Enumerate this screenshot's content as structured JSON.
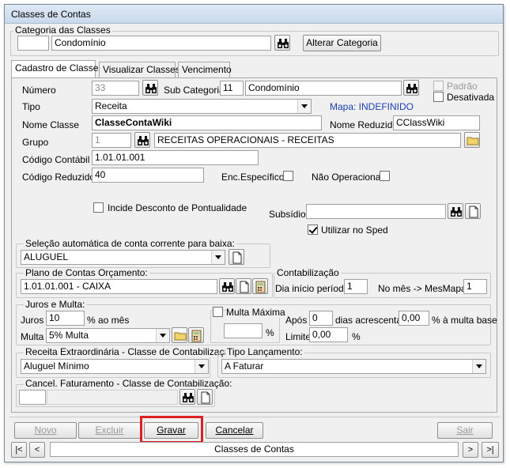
{
  "window": {
    "title": "Classes de Contas"
  },
  "categoria": {
    "legend": "Categoria das Classes",
    "code": "",
    "name": "Condomínio",
    "alterar_label": "Alterar Categoria"
  },
  "tabs": [
    {
      "label": "Cadastro de Classes"
    },
    {
      "label": "Visualizar Classes"
    },
    {
      "label": "Vencimento"
    }
  ],
  "form": {
    "numero_label": "Número",
    "numero": "33",
    "subcat_label": "Sub Categoria",
    "subcat_code": "11",
    "subcat_name": "Condomínio",
    "padrao_label": "Padrão",
    "desativada_label": "Desativada",
    "tipo_label": "Tipo",
    "tipo": "Receita",
    "mapa": "Mapa: INDEFINIDO",
    "nome_classe_label": "Nome Classe",
    "nome_classe": "ClasseContaWiki",
    "nome_reduzido_label": "Nome Reduzido",
    "nome_reduzido": "CClassWiki",
    "grupo_label": "Grupo",
    "grupo_code": "1",
    "grupo_name": "RECEITAS OPERACIONAIS - RECEITAS",
    "codigo_contabil_label": "Código Contábil",
    "codigo_contabil": "1.01.01.001",
    "codigo_reduzido_label": "Código Reduzido",
    "codigo_reduzido": "40",
    "enc_especifico_label": "Enc.Específico",
    "nao_operacional_label": "Não Operacional",
    "incide_label": "Incide Desconto de Pontualidade",
    "subsidio_label": "Subsídio",
    "subsidio": "",
    "utilizar_sped_label": "Utilizar no Sped"
  },
  "selecao": {
    "legend": "Seleção automática de conta corrente para baixa:",
    "value": "ALUGUEL"
  },
  "plano": {
    "legend": "Plano de Contas Orçamento:",
    "value": "1.01.01.001 - CAIXA"
  },
  "contabilizacao": {
    "legend": "Contabilização",
    "dia_label": "Dia início período",
    "dia": "1",
    "mes_label": "No mês -> MesMapa+",
    "mes": "1"
  },
  "juros": {
    "legend": "Juros e Multa:",
    "juros_label": "Juros",
    "juros": "10",
    "ao_mes": "% ao mês",
    "multa_label": "Multa",
    "multa": "5% Multa",
    "multa_maxima_label": "Multa Máxima",
    "multa_maxima": "",
    "pct": "%",
    "apos_label": "Após",
    "apos": "0",
    "dias_label": "dias acrescentar",
    "acrescentar": "0,00",
    "a_multa_base": "% à multa base",
    "limite_label": "Limite",
    "limite": "0,00",
    "pct2": "%"
  },
  "receita_extra": {
    "legend": "Receita Extraordinária - Classe de Contabilização:",
    "value": "Aluguel Mínimo"
  },
  "tipo_lancamento": {
    "legend": "Tipo Lançamento:",
    "value": "A Faturar"
  },
  "cancel_faturamento": {
    "legend": "Cancel. Faturamento - Classe de Contabilização:",
    "code": ""
  },
  "buttons": {
    "novo": "Novo",
    "excluir": "Excluir",
    "gravar": "Gravar",
    "cancelar": "Cancelar",
    "sair": "Sair"
  },
  "nav": {
    "first": "|<",
    "prev": "<",
    "record": "Classes de Contas",
    "next": ">",
    "last": ">|"
  },
  "colors": {
    "highlight": "#e02020",
    "mapa": "#1c3fb8"
  },
  "icons": [
    "binoculars-icon",
    "new-document-icon",
    "folder-icon",
    "calculator-icon"
  ]
}
